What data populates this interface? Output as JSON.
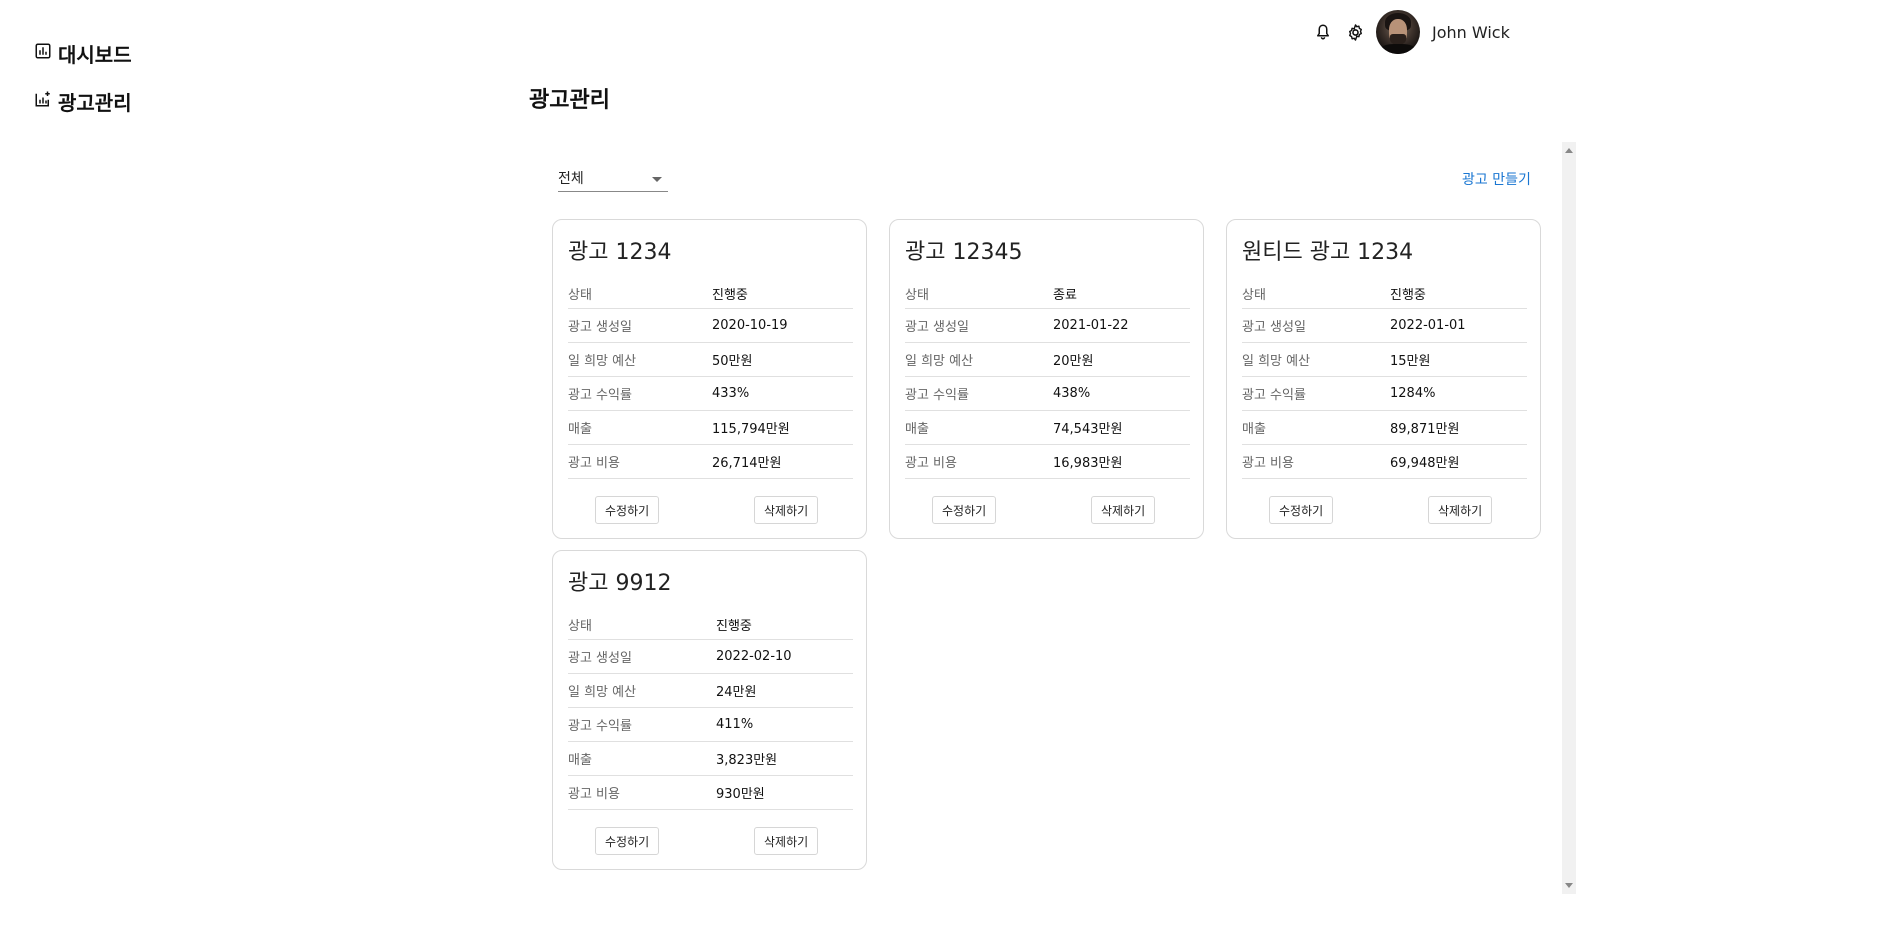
{
  "sidebar": {
    "items": [
      {
        "label": "대시보드",
        "icon": "bar-chart-icon"
      },
      {
        "label": "광고관리",
        "icon": "add-chart-icon"
      }
    ]
  },
  "header": {
    "user_name": "John Wick",
    "icons": [
      "bell-icon",
      "gear-icon"
    ]
  },
  "page": {
    "title": "광고관리",
    "filter": {
      "selected": "전체"
    },
    "create_label": "광고 만들기"
  },
  "cards": [
    {
      "title": "광고 1234",
      "rows": [
        {
          "label": "상태",
          "value": "진행중"
        },
        {
          "label": "광고 생성일",
          "value": "2020-10-19"
        },
        {
          "label": "일 희망 예산",
          "value": "50만원"
        },
        {
          "label": "광고 수익률",
          "value": "433%"
        },
        {
          "label": "매출",
          "value": "115,794만원"
        },
        {
          "label": "광고 비용",
          "value": "26,714만원"
        }
      ],
      "edit_label": "수정하기",
      "delete_label": "삭제하기"
    },
    {
      "title": "광고 12345",
      "rows": [
        {
          "label": "상태",
          "value": "종료"
        },
        {
          "label": "광고 생성일",
          "value": "2021-01-22"
        },
        {
          "label": "일 희망 예산",
          "value": "20만원"
        },
        {
          "label": "광고 수익률",
          "value": "438%"
        },
        {
          "label": "매출",
          "value": "74,543만원"
        },
        {
          "label": "광고 비용",
          "value": "16,983만원"
        }
      ],
      "edit_label": "수정하기",
      "delete_label": "삭제하기"
    },
    {
      "title": "원티드 광고 1234",
      "rows": [
        {
          "label": "상태",
          "value": "진행중"
        },
        {
          "label": "광고 생성일",
          "value": "2022-01-01"
        },
        {
          "label": "일 희망 예산",
          "value": "15만원"
        },
        {
          "label": "광고 수익률",
          "value": "1284%"
        },
        {
          "label": "매출",
          "value": "89,871만원"
        },
        {
          "label": "광고 비용",
          "value": "69,948만원"
        }
      ],
      "edit_label": "수정하기",
      "delete_label": "삭제하기"
    },
    {
      "title": "광고 9912",
      "rows": [
        {
          "label": "상태",
          "value": "진행중"
        },
        {
          "label": "광고 생성일",
          "value": "2022-02-10"
        },
        {
          "label": "일 희망 예산",
          "value": "24만원"
        },
        {
          "label": "광고 수익률",
          "value": "411%"
        },
        {
          "label": "매출",
          "value": "3,823만원"
        },
        {
          "label": "광고 비용",
          "value": "930만원"
        }
      ],
      "edit_label": "수정하기",
      "delete_label": "삭제하기"
    }
  ]
}
